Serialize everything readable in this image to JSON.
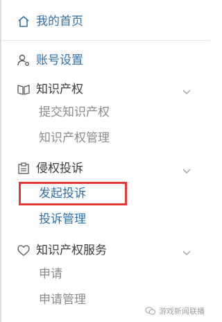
{
  "menu": {
    "home": {
      "label": "我的首页",
      "icon": "home-icon"
    },
    "account": {
      "label": "账号设置",
      "icon": "user-settings-icon"
    },
    "ip": {
      "label": "知识产权",
      "icon": "book-icon",
      "items": [
        {
          "label": "提交知识产权"
        },
        {
          "label": "知识产权管理"
        }
      ]
    },
    "complaint": {
      "label": "侵权投诉",
      "icon": "clipboard-icon",
      "items": [
        {
          "label": "发起投诉"
        },
        {
          "label": "投诉管理"
        }
      ]
    },
    "ip_service": {
      "label": "知识产权服务",
      "icon": "heart-icon",
      "items": [
        {
          "label": "申请"
        },
        {
          "label": "申请管理"
        }
      ]
    }
  },
  "colors": {
    "link_blue": "#2e6fa8",
    "text_dark": "#3c3c3c",
    "text_gray": "#8a8a8a",
    "highlight_red": "#e53935"
  },
  "watermark": {
    "label": "游戏新闻联播"
  }
}
